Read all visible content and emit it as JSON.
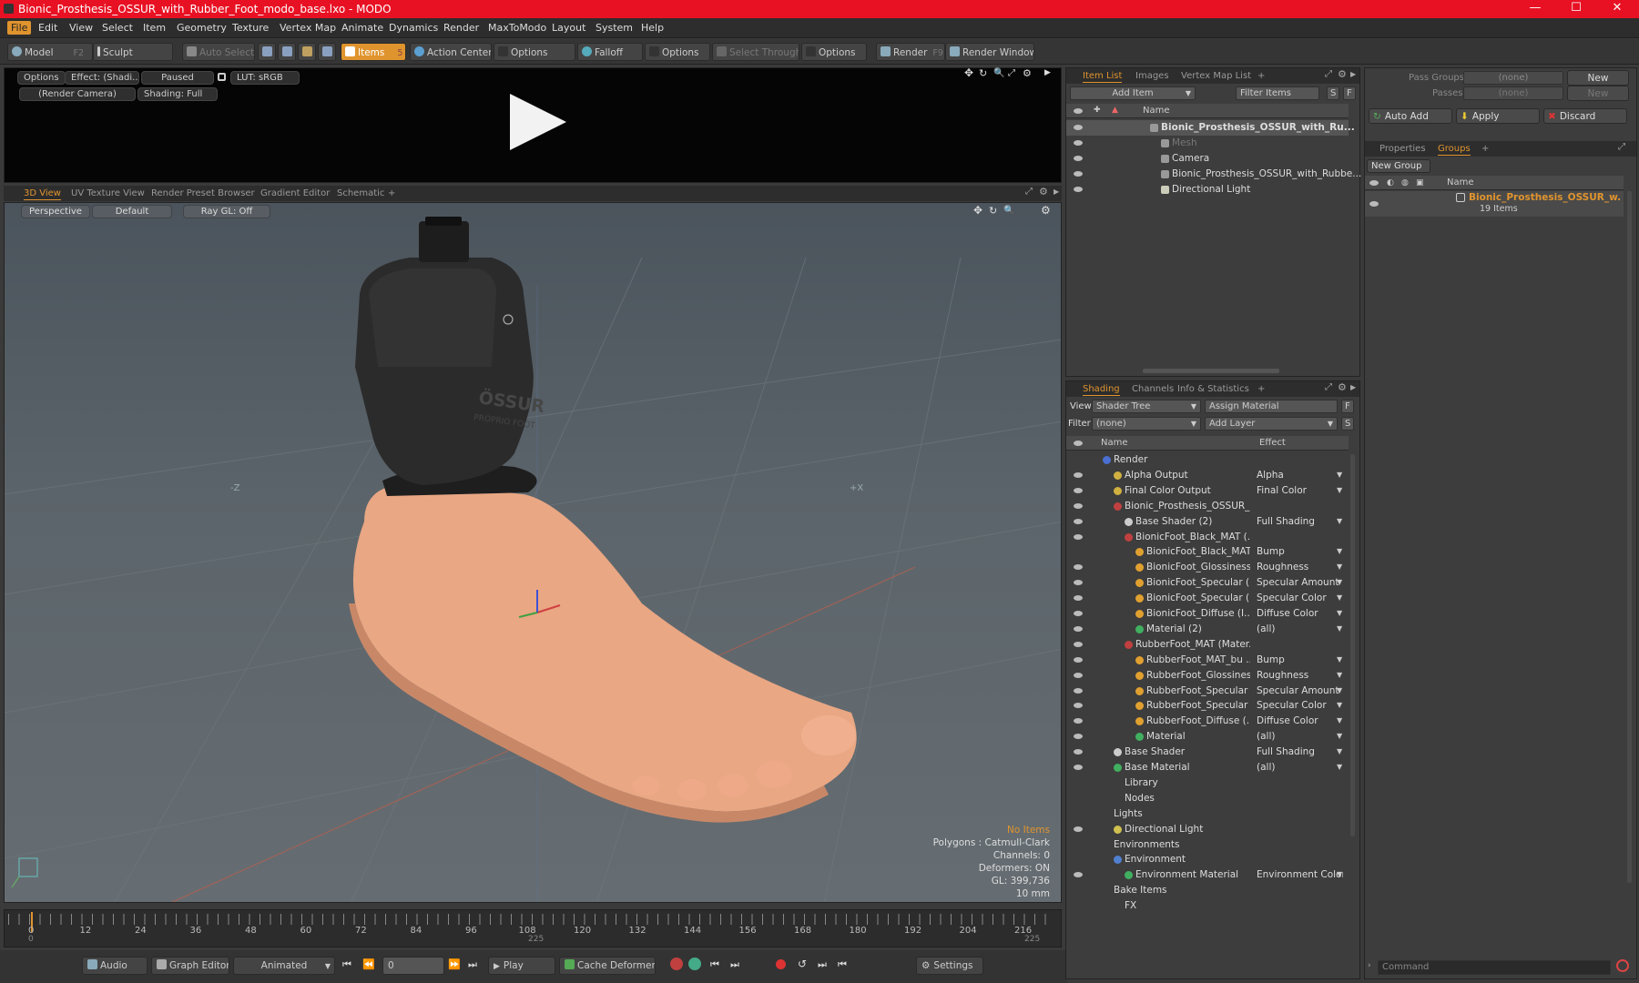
{
  "window": {
    "title": "Bionic_Prosthesis_OSSUR_with_Rubber_Foot_modo_base.lxo - MODO",
    "min": "—",
    "max": "☐",
    "close": "✕"
  },
  "menu": [
    "File",
    "Edit",
    "View",
    "Select",
    "Item",
    "Geometry",
    "Texture",
    "Vertex Map",
    "Animate",
    "Dynamics",
    "Render",
    "MaxToModo",
    "Layout",
    "System",
    "Help"
  ],
  "toolbar": {
    "model": "Model",
    "model_key": "F2",
    "sculpt": "Sculpt",
    "auto_select": "Auto Select",
    "items": "Items",
    "items_key": "5",
    "action_center": "Action Center",
    "options1": "Options",
    "falloff": "Falloff",
    "options2": "Options",
    "select_through": "Select Through",
    "options3": "Options",
    "render": "Render",
    "render_key": "F9",
    "render_window": "Render Window"
  },
  "preview": {
    "options": "Options",
    "effect": "Effect: (Shadi...",
    "paused": "Paused",
    "lut": "LUT: sRGB",
    "camera": "(Render Camera)",
    "shading": "Shading: Full"
  },
  "viewport_tabs": [
    "3D View",
    "UV Texture View",
    "Render Preset Browser",
    "Gradient Editor",
    "Schematic",
    "+"
  ],
  "viewport": {
    "perspective": "Perspective",
    "default": "Default",
    "raygl": "Ray GL: Off",
    "axis_neg_z": "-Z",
    "axis_pos_x": "+X",
    "stats": {
      "items": "No Items",
      "polygons": "Polygons : Catmull-Clark",
      "channels": "Channels: 0",
      "deformers": "Deformers: ON",
      "gl": "GL: 399,736",
      "unit": "10 mm"
    },
    "brand": "ÖSSUR",
    "brand_sub": "PROPRIO FOOT"
  },
  "timeline": {
    "ticks": [
      "0",
      "12",
      "24",
      "36",
      "48",
      "60",
      "72",
      "84",
      "96",
      "108",
      "120",
      "132",
      "144",
      "156",
      "168",
      "180",
      "192",
      "204",
      "216"
    ],
    "start": "0",
    "mid": "225",
    "end": "225"
  },
  "bottombar": {
    "audio": "Audio",
    "graph_editor": "Graph Editor",
    "animated": "Animated",
    "frame": "0",
    "play": "Play",
    "cache": "Cache Deformers",
    "settings": "Settings"
  },
  "item_list": {
    "tabs": [
      "Item List",
      "Images",
      "Vertex Map List",
      "+"
    ],
    "add_item": "Add Item",
    "filter": "Filter Items",
    "s": "S",
    "f": "F",
    "col_name": "Name",
    "rows": [
      {
        "label": "Bionic_Prosthesis_OSSUR_with_Ru...",
        "bold": true,
        "indent": 0
      },
      {
        "label": "Mesh",
        "dim": true,
        "indent": 1
      },
      {
        "label": "Camera",
        "indent": 1
      },
      {
        "label": "Bionic_Prosthesis_OSSUR_with_Rubbe...",
        "indent": 1
      },
      {
        "label": "Directional Light",
        "indent": 1
      }
    ]
  },
  "shading": {
    "tabs": [
      "Shading",
      "Channels",
      "Info & Statistics",
      "+"
    ],
    "view_label": "View",
    "view_value": "Shader Tree",
    "assign": "Assign Material",
    "filter_label": "Filter",
    "filter_value": "(none)",
    "add_layer": "Add Layer",
    "col_name": "Name",
    "col_effect": "Effect",
    "rows": [
      {
        "name": "Render",
        "effect": "",
        "indent": 0,
        "color": "#4a6fd0",
        "eye": false
      },
      {
        "name": "Alpha Output",
        "effect": "Alpha",
        "indent": 1,
        "color": "#d0b040",
        "eye": true
      },
      {
        "name": "Final Color Output",
        "effect": "Final Color",
        "indent": 1,
        "color": "#d0b040",
        "eye": true
      },
      {
        "name": "Bionic_Prosthesis_OSSUR_...",
        "effect": "",
        "indent": 1,
        "color": "#c04040",
        "eye": true
      },
      {
        "name": "Base Shader (2)",
        "effect": "Full Shading",
        "indent": 2,
        "color": "#cccccc",
        "eye": true
      },
      {
        "name": "BionicFoot_Black_MAT (...",
        "effect": "",
        "indent": 2,
        "color": "#c04040",
        "eye": true
      },
      {
        "name": "BionicFoot_Black_MAT ...",
        "effect": "Bump",
        "indent": 3,
        "color": "#e0a030",
        "eye": false
      },
      {
        "name": "BionicFoot_Glossiness ...",
        "effect": "Roughness",
        "indent": 3,
        "color": "#e0a030",
        "eye": true
      },
      {
        "name": "BionicFoot_Specular (I...",
        "effect": "Specular Amount",
        "indent": 3,
        "color": "#e0a030",
        "eye": true
      },
      {
        "name": "BionicFoot_Specular (I...",
        "effect": "Specular Color",
        "indent": 3,
        "color": "#e0a030",
        "eye": true
      },
      {
        "name": "BionicFoot_Diffuse (I...",
        "effect": "Diffuse Color",
        "indent": 3,
        "color": "#e0a030",
        "eye": true
      },
      {
        "name": "Material (2)",
        "effect": "(all)",
        "indent": 3,
        "color": "#40b060",
        "eye": true
      },
      {
        "name": "RubberFoot_MAT (Mater...",
        "effect": "",
        "indent": 2,
        "color": "#c04040",
        "eye": true
      },
      {
        "name": "RubberFoot_MAT_bu ...",
        "effect": "Bump",
        "indent": 3,
        "color": "#e0a030",
        "eye": true
      },
      {
        "name": "RubberFoot_Glossines...",
        "effect": "Roughness",
        "indent": 3,
        "color": "#e0a030",
        "eye": true
      },
      {
        "name": "RubberFoot_Specular ...",
        "effect": "Specular Amount",
        "indent": 3,
        "color": "#e0a030",
        "eye": true
      },
      {
        "name": "RubberFoot_Specular ...",
        "effect": "Specular Color",
        "indent": 3,
        "color": "#e0a030",
        "eye": true
      },
      {
        "name": "RubberFoot_Diffuse (...",
        "effect": "Diffuse Color",
        "indent": 3,
        "color": "#e0a030",
        "eye": true
      },
      {
        "name": "Material",
        "effect": "(all)",
        "indent": 3,
        "color": "#40b060",
        "eye": true
      },
      {
        "name": "Base Shader",
        "effect": "Full Shading",
        "indent": 1,
        "color": "#cccccc",
        "eye": true
      },
      {
        "name": "Base Material",
        "effect": "(all)",
        "indent": 1,
        "color": "#40b060",
        "eye": true
      },
      {
        "name": "Library",
        "effect": "",
        "indent": 1,
        "color": "",
        "eye": false
      },
      {
        "name": "Nodes",
        "effect": "",
        "indent": 1,
        "color": "",
        "eye": false
      },
      {
        "name": "Lights",
        "effect": "",
        "indent": 0,
        "color": "",
        "eye": false
      },
      {
        "name": "Directional Light",
        "effect": "",
        "indent": 1,
        "color": "#d0c050",
        "eye": true
      },
      {
        "name": "Environments",
        "effect": "",
        "indent": 0,
        "color": "",
        "eye": false
      },
      {
        "name": "Environment",
        "effect": "",
        "indent": 1,
        "color": "#5080d0",
        "eye": false
      },
      {
        "name": "Environment Material",
        "effect": "Environment Color",
        "indent": 2,
        "color": "#40b060",
        "eye": true
      },
      {
        "name": "Bake Items",
        "effect": "",
        "indent": 0,
        "color": "",
        "eye": false
      },
      {
        "name": "FX",
        "effect": "",
        "indent": 1,
        "color": "",
        "eye": false
      }
    ]
  },
  "right": {
    "pass_groups": "Pass Groups",
    "passes": "Passes",
    "none1": "(none)",
    "none2": "(none)",
    "new1": "New",
    "new2": "New",
    "auto_add": "Auto Add",
    "apply": "Apply",
    "discard": "Discard",
    "tabs": [
      "Properties",
      "Groups",
      "+"
    ],
    "new_group": "New Group",
    "col_name": "Name",
    "group_name": "Bionic_Prosthesis_OSSUR_w...",
    "group_count": "19 Items",
    "command": "Command"
  },
  "colors": {
    "accent": "#e0942e",
    "title": "#e81123",
    "skin": "#f0a882",
    "socket": "#2a2a2a"
  }
}
